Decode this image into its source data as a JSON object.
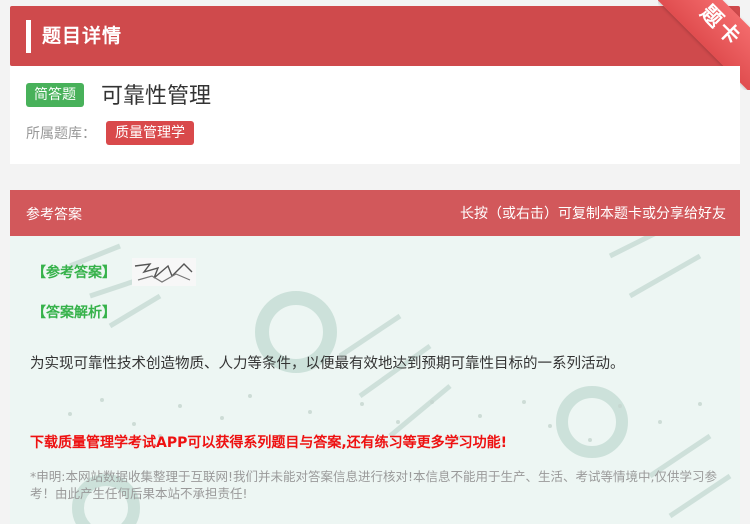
{
  "header": {
    "title": "题目详情",
    "corner_badge": "题卡"
  },
  "question": {
    "type_tag": "简答题",
    "title": "可靠性管理",
    "bank_label": "所属题库：",
    "bank_name": "质量管理学"
  },
  "answer_section": {
    "header_left": "参考答案",
    "header_right": "长按（或右击）可复制本题卡或分享给好友",
    "ref_answer_label": "【参考答案】",
    "explanation_label": "【答案解析】",
    "explanation_text": "为实现可靠性技术创造物质、人力等条件，以便最有效地达到预期可靠性目标的一系列活动。",
    "promo_text": "下载质量管理学考试APP可以获得系列题目与答案,还有练习等更多学习功能!",
    "disclaimer": "*申明:本网站数据收集整理于互联网!我们并未能对答案信息进行核对!本信息不能用于生产、生活、考试等情境中,仅供学习参考！由此产生任何后果本站不承担责任!"
  },
  "colors": {
    "header_red": "#cf4a4c",
    "answer_head_red": "#d2585b",
    "tag_green": "#48b15a",
    "tag_red": "#d9494b",
    "label_green": "#36b24a",
    "promo_red": "#ee1111",
    "answer_bg": "#edf6f3"
  }
}
